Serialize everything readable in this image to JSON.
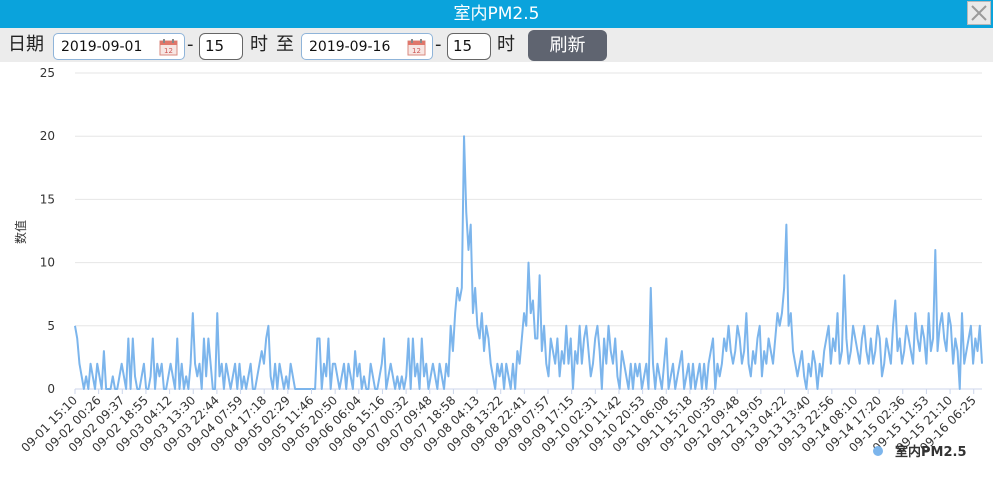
{
  "window": {
    "title": "室内PM2.5"
  },
  "toolbar": {
    "date_label": "日期",
    "start_date": "2019-09-01",
    "dash1": "-",
    "start_hour": "15",
    "hour_label1": "时",
    "to_label": "至",
    "end_date": "2019-09-16",
    "dash2": "-",
    "end_hour": "15",
    "hour_label2": "时",
    "refresh_label": "刷新"
  },
  "colors": {
    "titlebar": "#0aa3dc",
    "series": "#7cb5ec",
    "button": "#5f6470"
  },
  "icons": {
    "close": "close-icon",
    "calendar": "calendar-icon"
  },
  "chart_data": {
    "type": "line",
    "title": "",
    "xlabel": "",
    "ylabel": "数值",
    "ylim": [
      0,
      25
    ],
    "yticks": [
      0,
      5,
      10,
      15,
      20,
      25
    ],
    "grid": true,
    "legend": "bottom-right",
    "x_tick_labels": [
      "09-01 15:10",
      "09-02 00:26",
      "09-02 09:37",
      "09-02 18:55",
      "09-03 04:12",
      "09-03 13:30",
      "09-03 22:44",
      "09-04 07:59",
      "09-04 17:18",
      "09-05 02:29",
      "09-05 11:46",
      "09-05 20:50",
      "09-06 06:04",
      "09-06 15:16",
      "09-07 00:32",
      "09-07 09:48",
      "09-07 18:58",
      "09-08 04:13",
      "09-08 13:22",
      "09-08 22:41",
      "09-09 07:57",
      "09-09 17:15",
      "09-10 02:31",
      "09-10 11:42",
      "09-10 20:53",
      "09-11 06:08",
      "09-11 15:18",
      "09-12 00:35",
      "09-12 09:48",
      "09-12 19:05",
      "09-13 04:22",
      "09-13 13:40",
      "09-13 22:56",
      "09-14 08:10",
      "09-14 17:20",
      "09-15 02:36",
      "09-15 11:53",
      "09-15 21:10",
      "09-16 06:25"
    ],
    "series": [
      {
        "name": "室内PM2.5",
        "values": [
          5,
          4,
          2,
          1,
          0,
          1,
          0,
          2,
          1,
          0,
          2,
          1,
          0,
          3,
          0,
          0,
          0,
          1,
          0,
          0,
          1,
          2,
          1,
          0,
          4,
          0,
          4,
          1,
          0,
          0,
          1,
          2,
          0,
          0,
          1,
          4,
          0,
          2,
          1,
          2,
          0,
          0,
          1,
          2,
          1,
          0,
          4,
          0,
          2,
          0,
          1,
          0,
          2,
          6,
          2,
          1,
          2,
          0,
          4,
          1,
          4,
          2,
          0,
          0,
          6,
          1,
          2,
          0,
          2,
          1,
          0,
          1,
          2,
          0,
          2,
          0,
          1,
          0,
          1,
          2,
          0,
          0,
          1,
          2,
          3,
          2,
          4,
          5,
          1,
          0,
          2,
          0,
          2,
          1,
          0,
          1,
          0,
          2,
          1,
          0,
          0,
          0,
          0,
          0,
          0,
          0,
          0,
          0,
          0,
          4,
          4,
          0,
          2,
          1,
          4,
          0,
          2,
          2,
          1,
          0,
          1,
          2,
          0,
          2,
          1,
          0,
          3,
          1,
          2,
          0,
          1,
          0,
          0,
          2,
          1,
          0,
          0,
          1,
          2,
          4,
          0,
          1,
          2,
          1,
          0,
          1,
          0,
          1,
          0,
          1,
          4,
          0,
          4,
          1,
          2,
          0,
          4,
          1,
          2,
          0,
          1,
          2,
          1,
          0,
          2,
          1,
          0,
          2,
          1,
          5,
          3,
          6,
          8,
          7,
          8,
          20,
          14,
          11,
          13,
          6,
          8,
          5,
          4,
          6,
          3,
          5,
          4,
          2,
          1,
          0,
          2,
          1,
          2,
          0,
          2,
          1,
          0,
          2,
          0,
          3,
          2,
          4,
          6,
          5,
          10,
          6,
          7,
          4,
          4,
          9,
          3,
          5,
          2,
          1,
          4,
          3,
          2,
          4,
          1,
          3,
          2,
          5,
          2,
          4,
          0,
          3,
          2,
          5,
          2,
          4,
          5,
          3,
          1,
          2,
          4,
          5,
          3,
          0,
          4,
          2,
          5,
          3,
          2,
          4,
          1,
          0,
          3,
          2,
          1,
          0,
          2,
          0,
          2,
          1,
          2,
          0,
          1,
          2,
          0,
          8,
          2,
          0,
          2,
          1,
          0,
          2,
          4,
          0,
          1,
          2,
          0,
          1,
          2,
          3,
          0,
          1,
          2,
          0,
          2,
          0,
          1,
          2,
          0,
          2,
          0,
          2,
          3,
          4,
          0,
          2,
          1,
          2,
          4,
          3,
          5,
          3,
          2,
          3,
          5,
          4,
          2,
          3,
          6,
          2,
          1,
          3,
          2,
          4,
          5,
          1,
          3,
          2,
          4,
          3,
          2,
          4,
          6,
          5,
          6,
          8,
          13,
          5,
          6,
          3,
          2,
          1,
          2,
          3,
          1,
          0,
          2,
          1,
          3,
          2,
          0,
          2,
          1,
          3,
          4,
          5,
          2,
          4,
          3,
          6,
          2,
          3,
          9,
          4,
          2,
          3,
          5,
          4,
          3,
          2,
          4,
          5,
          3,
          2,
          4,
          2,
          3,
          5,
          4,
          1,
          2,
          4,
          3,
          2,
          5,
          7,
          3,
          4,
          2,
          3,
          5,
          4,
          3,
          2,
          6,
          4,
          3,
          5,
          4,
          2,
          6,
          3,
          4,
          11,
          3,
          5,
          6,
          4,
          3,
          6,
          5,
          2,
          4,
          3,
          0,
          6,
          2,
          3,
          4,
          5,
          2,
          4,
          3,
          5,
          2
        ]
      }
    ]
  }
}
